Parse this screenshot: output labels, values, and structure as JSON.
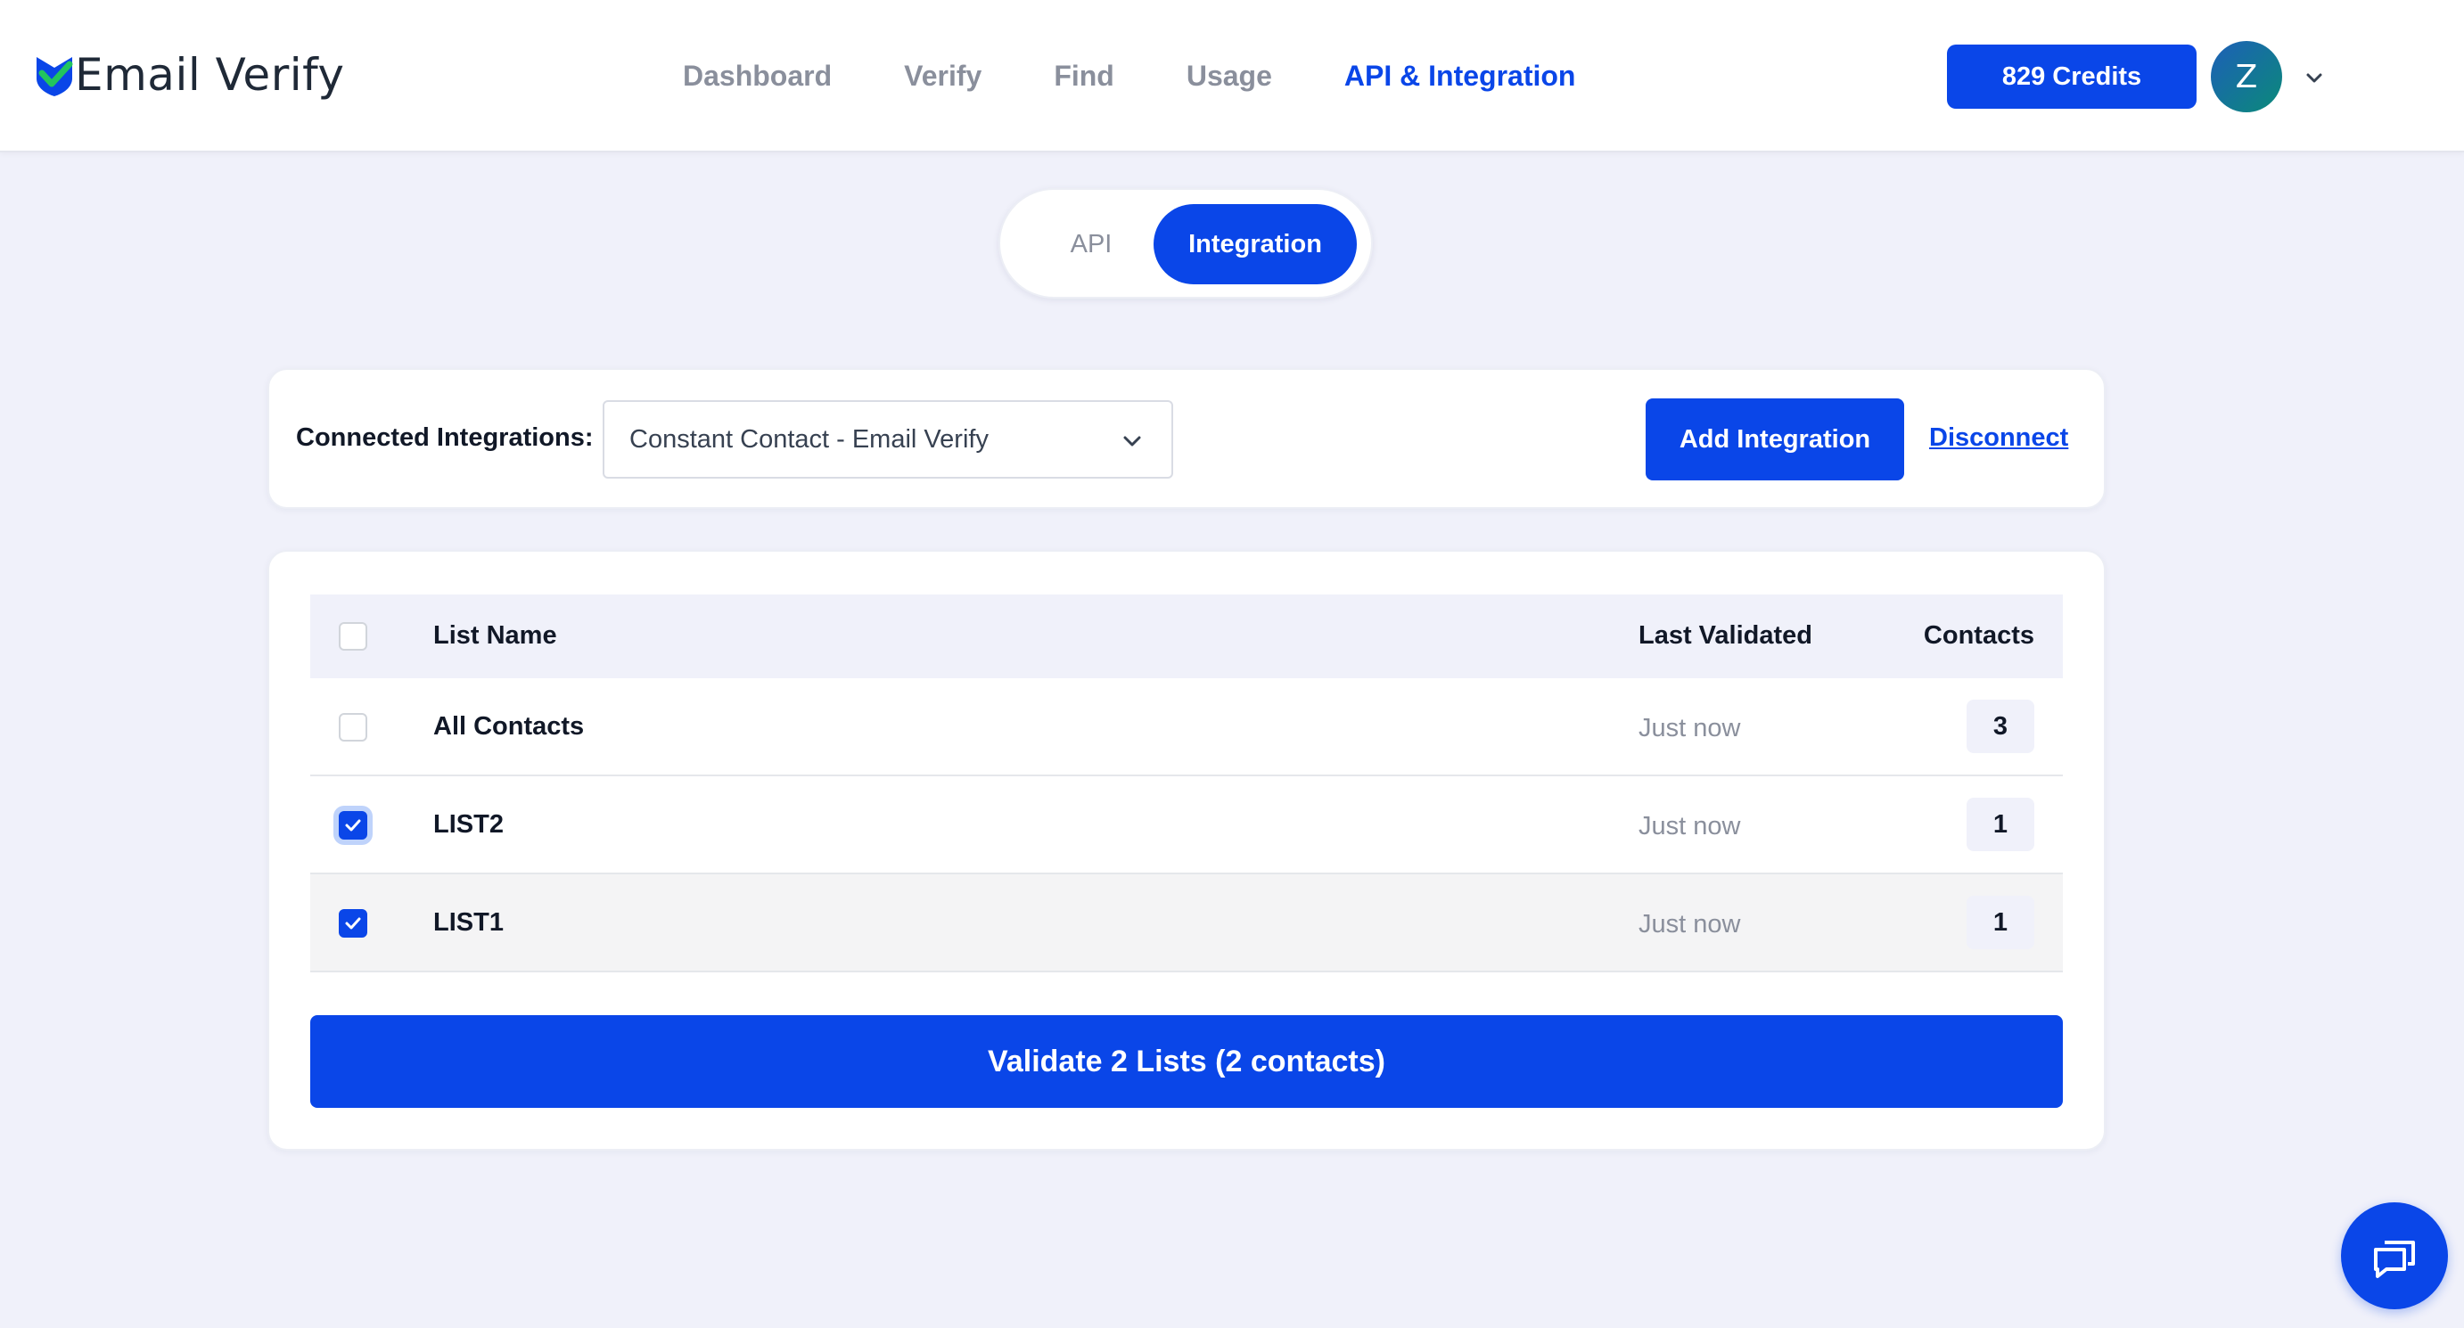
{
  "brand": {
    "name": "Email Verify",
    "accent_color": "#0a46e8",
    "logo_icon": "shield-check-icon"
  },
  "nav": {
    "items": [
      {
        "label": "Dashboard",
        "active": false
      },
      {
        "label": "Verify",
        "active": false
      },
      {
        "label": "Find",
        "active": false
      },
      {
        "label": "Usage",
        "active": false
      },
      {
        "label": "API & Integration",
        "active": true
      }
    ]
  },
  "header": {
    "credits_label": "829 Credits",
    "avatar_initial": "Z",
    "avatar_menu_icon": "chevron-down-icon"
  },
  "tabs": [
    {
      "label": "API",
      "active": false
    },
    {
      "label": "Integration",
      "active": true
    }
  ],
  "integrations": {
    "label": "Connected Integrations:",
    "selected": "Constant Contact - Email Verify",
    "add_label": "Add Integration",
    "disconnect_label": "Disconnect"
  },
  "lists": {
    "columns": {
      "name": "List Name",
      "last_validated": "Last Validated",
      "contacts": "Contacts"
    },
    "select_all_checked": false,
    "rows": [
      {
        "name": "All Contacts",
        "last_validated": "Just now",
        "contacts": "3",
        "checked": false
      },
      {
        "name": "LIST2",
        "last_validated": "Just now",
        "contacts": "1",
        "checked": true
      },
      {
        "name": "LIST1",
        "last_validated": "Just now",
        "contacts": "1",
        "checked": true
      }
    ],
    "validate_label": "Validate 2 Lists (2 contacts)"
  },
  "chat": {
    "icon": "chat-bubble-icon"
  }
}
